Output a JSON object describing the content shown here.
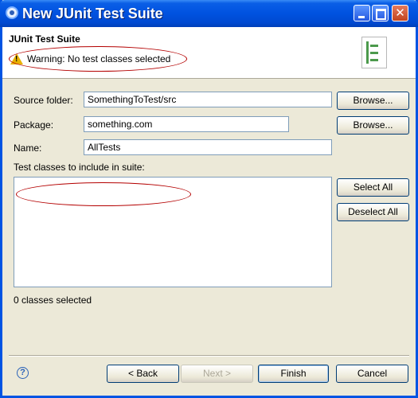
{
  "window": {
    "title": "New JUnit Test Suite"
  },
  "header": {
    "title": "JUnit Test Suite",
    "message": "Warning: No test classes selected"
  },
  "form": {
    "source_folder_label": "Source folder:",
    "source_folder_value": "SomethingToTest/src",
    "package_label": "Package:",
    "package_value": "something.com",
    "name_label": "Name:",
    "name_value": "AllTests",
    "browse_label": "Browse...",
    "classes_label": "Test classes to include in suite:",
    "select_all_label": "Select All",
    "deselect_all_label": "Deselect All",
    "status": "0 classes selected"
  },
  "footer": {
    "help_glyph": "?",
    "back_label": "< Back",
    "next_label": "Next >",
    "finish_label": "Finish",
    "cancel_label": "Cancel"
  },
  "colors": {
    "titlebar": "#0054e3",
    "annotation_ellipse": "#b40000",
    "warning_icon": "#e8b100"
  }
}
